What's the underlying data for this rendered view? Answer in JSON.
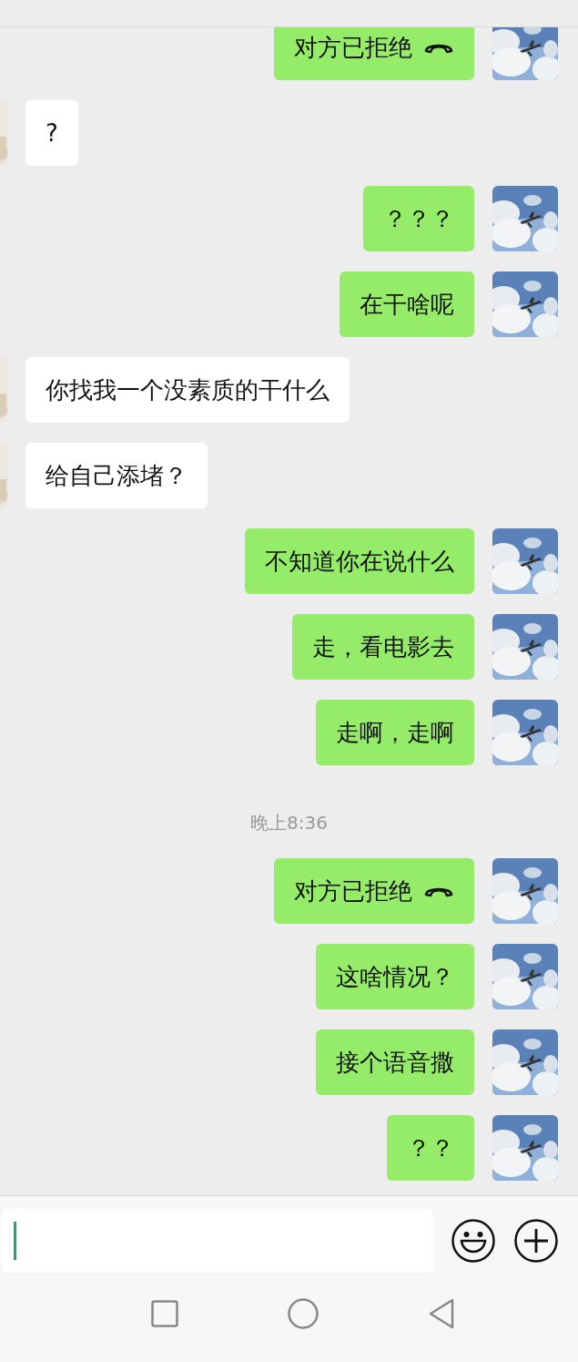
{
  "messages": [
    {
      "kind": "call",
      "sent": true,
      "text": "对方已拒绝"
    },
    {
      "kind": "text",
      "sent": false,
      "text": "?"
    },
    {
      "kind": "text",
      "sent": true,
      "text": "？？？"
    },
    {
      "kind": "text",
      "sent": true,
      "text": "在干啥呢"
    },
    {
      "kind": "text",
      "sent": false,
      "text": "你找我一个没素质的干什么"
    },
    {
      "kind": "text",
      "sent": false,
      "text": "给自己添堵？"
    },
    {
      "kind": "text",
      "sent": true,
      "text": "不知道你在说什么"
    },
    {
      "kind": "text",
      "sent": true,
      "text": "走，看电影去"
    },
    {
      "kind": "text",
      "sent": true,
      "text": "走啊，走啊"
    },
    {
      "kind": "time",
      "text": "晚上8:36"
    },
    {
      "kind": "call",
      "sent": true,
      "text": "对方已拒绝"
    },
    {
      "kind": "text",
      "sent": true,
      "text": "这啥情况？"
    },
    {
      "kind": "text",
      "sent": true,
      "text": "接个语音撒"
    },
    {
      "kind": "text",
      "sent": true,
      "text": "？？"
    }
  ]
}
